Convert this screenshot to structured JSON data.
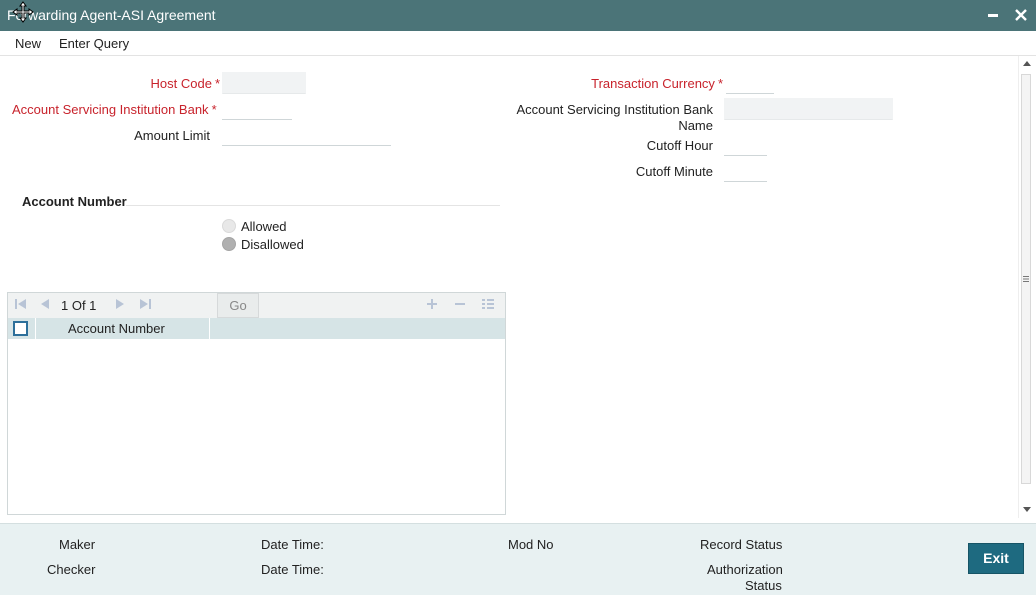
{
  "window": {
    "title": "Forwarding Agent-ASI Agreement"
  },
  "menu": {
    "new": "New",
    "enter_query": "Enter Query"
  },
  "form": {
    "host_code_label": "Host Code",
    "asi_bank_label": "Account Servicing Institution Bank",
    "amount_limit_label": "Amount Limit",
    "txn_currency_label": "Transaction Currency",
    "asi_bank_name_label_line1": "Account Servicing Institution Bank",
    "asi_bank_name_label_line2": "Name",
    "cutoff_hour_label": "Cutoff Hour",
    "cutoff_minute_label": "Cutoff Minute",
    "required_mark": "*"
  },
  "account_number_section": {
    "title": "Account Number",
    "options": [
      "Allowed",
      "Disallowed"
    ],
    "selected": "Disallowed"
  },
  "grid": {
    "pager": "1 Of 1",
    "go_label": "Go",
    "column": "Account Number"
  },
  "footer": {
    "maker": "Maker",
    "checker": "Checker",
    "date_time": "Date Time:",
    "mod_no": "Mod No",
    "record_status": "Record Status",
    "auth_status_line1": "Authorization",
    "auth_status_line2": "Status",
    "exit": "Exit"
  },
  "colors": {
    "titlebar": "#4b7478",
    "required": "#c8232c",
    "footer": "#e8f1f2",
    "exit": "#1e6a80"
  }
}
